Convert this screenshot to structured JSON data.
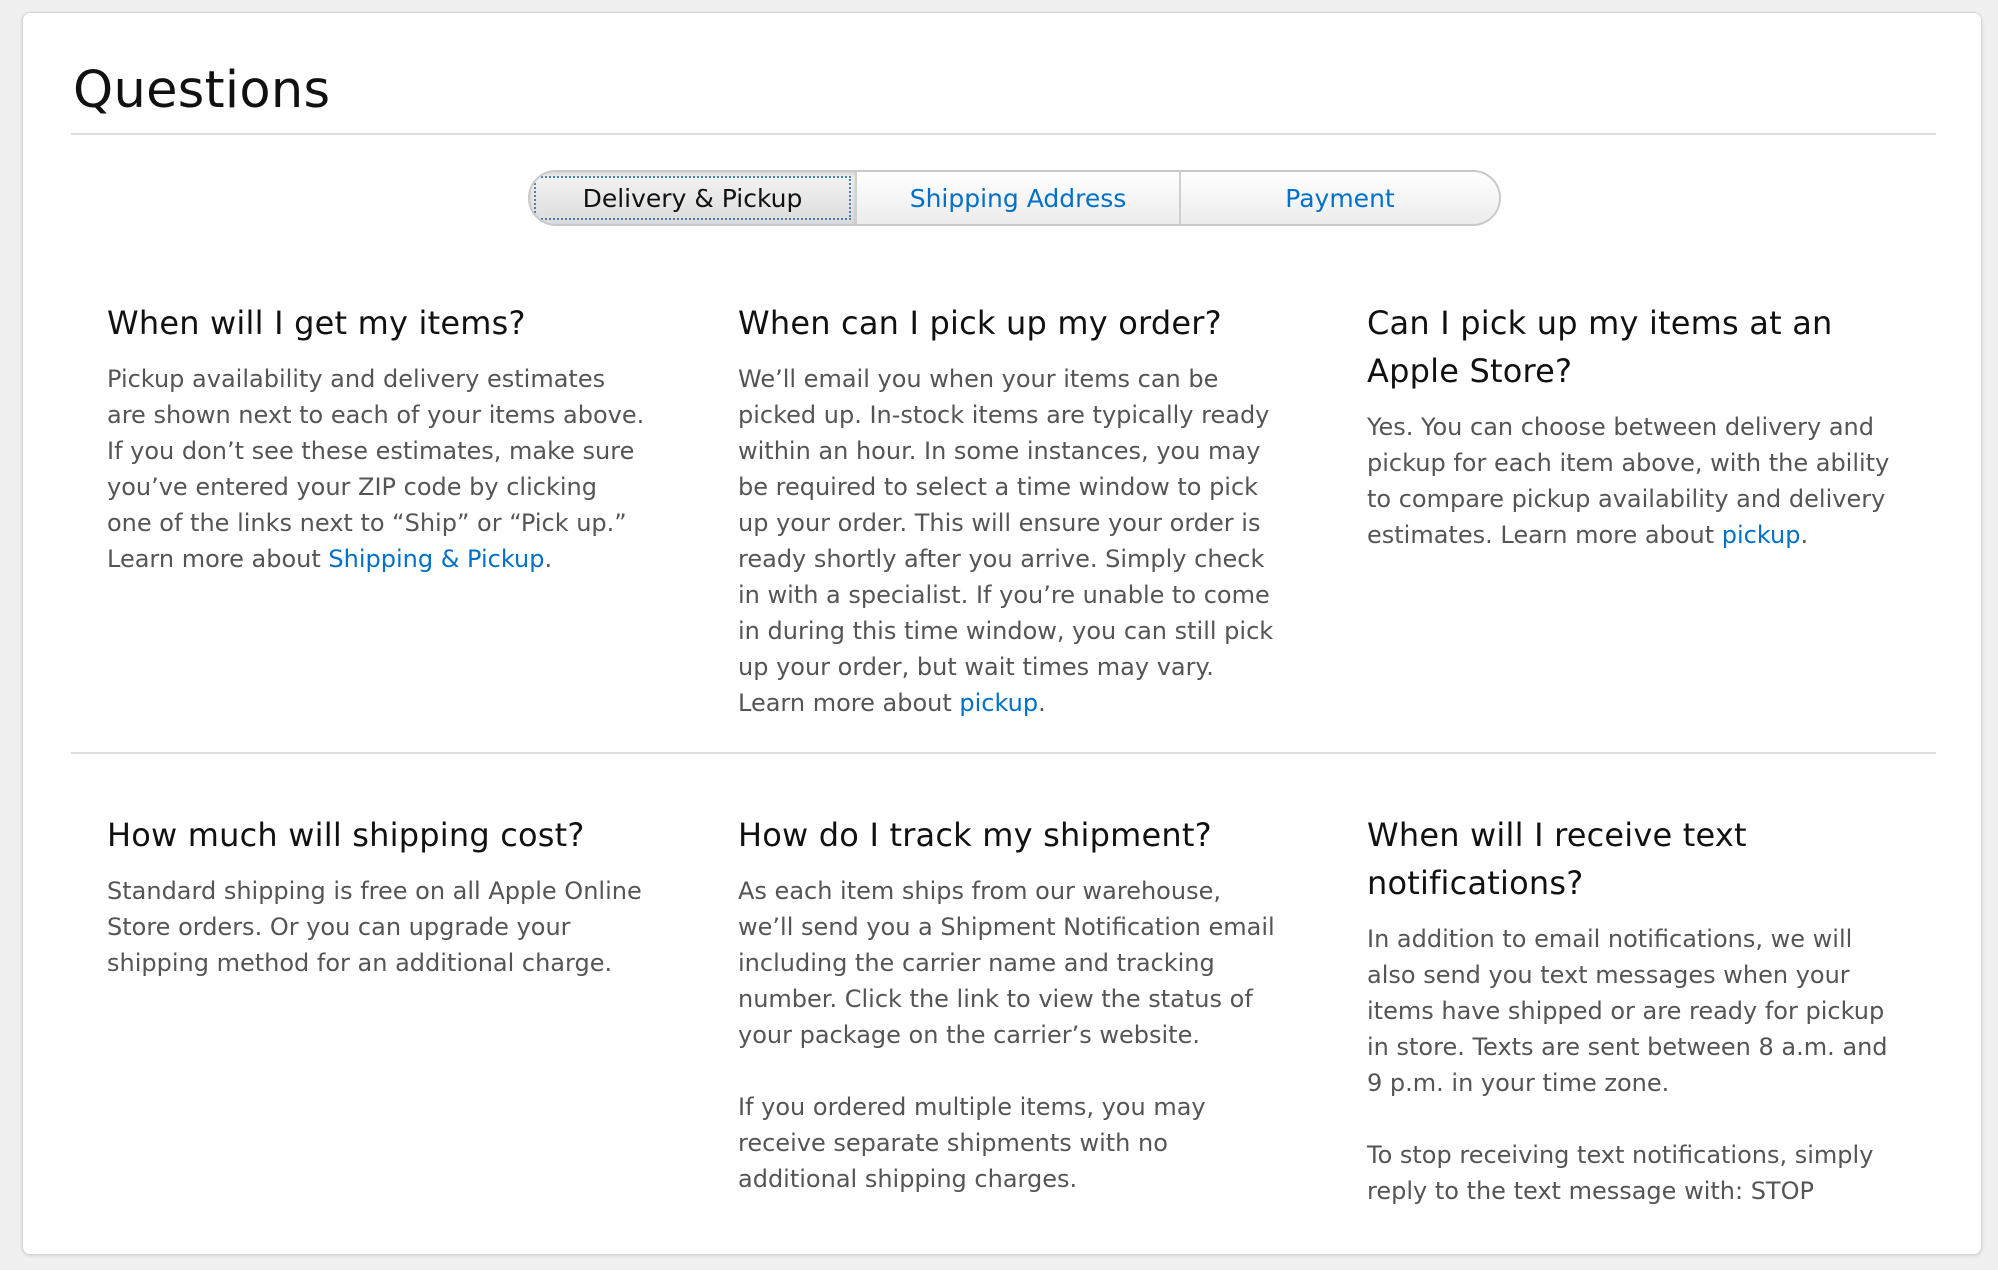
{
  "page": {
    "title": "Questions"
  },
  "tabs": [
    {
      "label": "Delivery & Pickup",
      "active": true
    },
    {
      "label": "Shipping Address",
      "active": false
    },
    {
      "label": "Payment",
      "active": false
    }
  ],
  "faqs": [
    {
      "question": "When will I get my items?",
      "body": "Pickup availability and delivery estimates are shown next to each of your items above. If you don’t see these estimates, make sure you’ve entered your ZIP code by clicking one of the links next to “Ship” or “Pick up.” Learn more about ",
      "link": "Shipping & Pickup",
      "after": "."
    },
    {
      "question": "When can I pick up my order?",
      "body": "We’ll email you when your items can be picked up. In-stock items are typically ready within an hour. In some instances, you may be required to select a time window to pick up your order. This will ensure your order is ready shortly after you arrive. Simply check in with a specialist. If you’re unable to come in during this time window, you can still pick up your order, but wait times may vary. Learn more about ",
      "link": "pickup",
      "after": "."
    },
    {
      "question": "Can I pick up my items at an Apple Store?",
      "body": "Yes. You can choose between delivery and pickup for each item above, with the ability to compare pickup availability and delivery estimates. Learn more about ",
      "link": "pickup",
      "after": "."
    },
    {
      "question": "How much will shipping cost?",
      "body": "Standard shipping is free on all Apple Online Store orders. Or you can upgrade your shipping method for an additional charge."
    },
    {
      "question": "How do I track my shipment?",
      "body": "As each item ships from our warehouse, we’ll send you a Shipment Notification email including the carrier name and tracking number. Click the link to view the status of your package on the carrier’s website.",
      "body2": "If you ordered multiple items, you may receive separate shipments with no additional shipping charges."
    },
    {
      "question": "When will I receive text notifications?",
      "body": "In addition to email notifications, we will also send you text messages when your items have shipped or are ready for pickup in store. Texts are sent between 8 a.m. and 9 p.m. in your time zone.",
      "body2": "To stop receiving text notifications, simply reply to the text message with: STOP"
    }
  ]
}
